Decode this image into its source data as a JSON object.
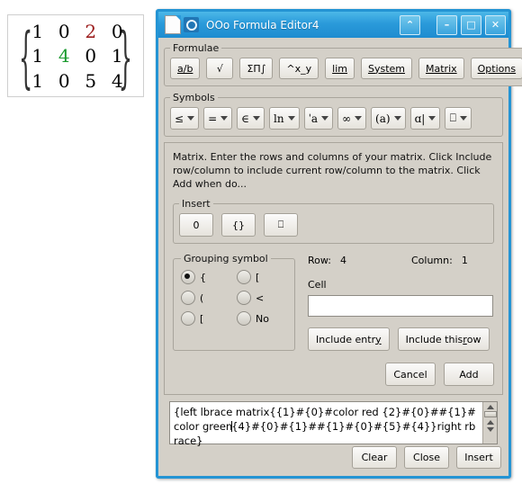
{
  "preview": {
    "left_brace": "{",
    "right_brace": "}",
    "rows": [
      [
        {
          "v": "1",
          "color": "#000000"
        },
        {
          "v": "0",
          "color": "#000000"
        },
        {
          "v": "2",
          "color": "#9b1c1c"
        },
        {
          "v": "0",
          "color": "#000000"
        }
      ],
      [
        {
          "v": "1",
          "color": "#000000"
        },
        {
          "v": "4",
          "color": "#1a9a2e"
        },
        {
          "v": "0",
          "color": "#000000"
        },
        {
          "v": "1",
          "color": "#000000"
        }
      ],
      [
        {
          "v": "1",
          "color": "#000000"
        },
        {
          "v": "0",
          "color": "#000000"
        },
        {
          "v": "5",
          "color": "#000000"
        },
        {
          "v": "4",
          "color": "#000000"
        }
      ]
    ]
  },
  "window": {
    "title": "OOo Formula Editor4",
    "rollup_label": "⌃",
    "minimize_label": "–",
    "maximize_label": "□",
    "close_label": "✕",
    "titlebar_color": "#2a9ada",
    "border_color": "#2494d4"
  },
  "formulae": {
    "legend": "Formulae",
    "buttons": [
      {
        "label": "a/b",
        "underline_first": true
      },
      {
        "label": "√",
        "underline_first": false
      },
      {
        "label": "ΣΠ∫",
        "underline_first": false
      },
      {
        "label": "^x_y",
        "underline_first": false
      },
      {
        "label": "lim",
        "underline_first": true
      },
      {
        "label": "System",
        "underline_first": true
      },
      {
        "label": "Matrix",
        "underline_first": true
      }
    ],
    "options_label": "Options"
  },
  "symbols": {
    "legend": "Symbols",
    "buttons": [
      {
        "glyph": "≤",
        "name": "relations-unary"
      },
      {
        "glyph": "=",
        "name": "relations"
      },
      {
        "glyph": "∈",
        "name": "set-operations"
      },
      {
        "glyph": "ln",
        "name": "functions"
      },
      {
        "glyph": "ˈa",
        "name": "attributes"
      },
      {
        "glyph": "∞",
        "name": "others"
      },
      {
        "glyph": "(a)",
        "name": "brackets"
      },
      {
        "glyph": "ɑ|",
        "name": "formats"
      },
      {
        "glyph": "⎕",
        "name": "symbols-catalog"
      }
    ]
  },
  "matrix_panel": {
    "help_text": "Matrix. Enter the rows and columns of your matrix. Click Include row/column to include current row/column to the matrix. Click Add when do...",
    "insert": {
      "legend": "Insert",
      "buttons": [
        {
          "label": "0",
          "name": "insert-zero"
        },
        {
          "label": "{}",
          "name": "insert-braces"
        },
        {
          "label": "⎕",
          "name": "insert-placeholder"
        }
      ]
    },
    "grouping": {
      "legend": "Grouping symbol",
      "options": [
        {
          "label": "{",
          "selected": true,
          "name": "brace"
        },
        {
          "label": "[",
          "selected": false,
          "name": "square-bracket"
        },
        {
          "label": "(",
          "selected": false,
          "name": "paren"
        },
        {
          "label": "<",
          "selected": false,
          "name": "angle"
        },
        {
          "label": "[",
          "selected": false,
          "name": "double-square"
        },
        {
          "label": "No",
          "selected": false,
          "name": "none"
        }
      ]
    },
    "row_label": "Row:",
    "row_value": "4",
    "column_label": "Column:",
    "column_value": "1",
    "cell_label": "Cell",
    "cell_value": "",
    "cell_placeholder": "",
    "include_entry_label": "Include entry",
    "include_this_row_label": "Include this row",
    "cancel_label": "Cancel",
    "add_label": "Add"
  },
  "formula_text": {
    "line1": "{left lbrace matrix{{1}#{0}#color red {2}#{0}##{1}#color",
    "line2_before_caret": "green",
    "line2_after_caret": "{4}#{0}#{1}##{1}#{0}#{5}#{4}}right rbrace}",
    "full": "{left lbrace matrix{{1}#{0}#color red {2}#{0}##{1}#color green{4}#{0}#{1}##{1}#{0}#{5}#{4}}right rbrace}"
  },
  "bottom_buttons": {
    "clear_label": "Clear",
    "close_label": "Close",
    "insert_label": "Insert"
  }
}
